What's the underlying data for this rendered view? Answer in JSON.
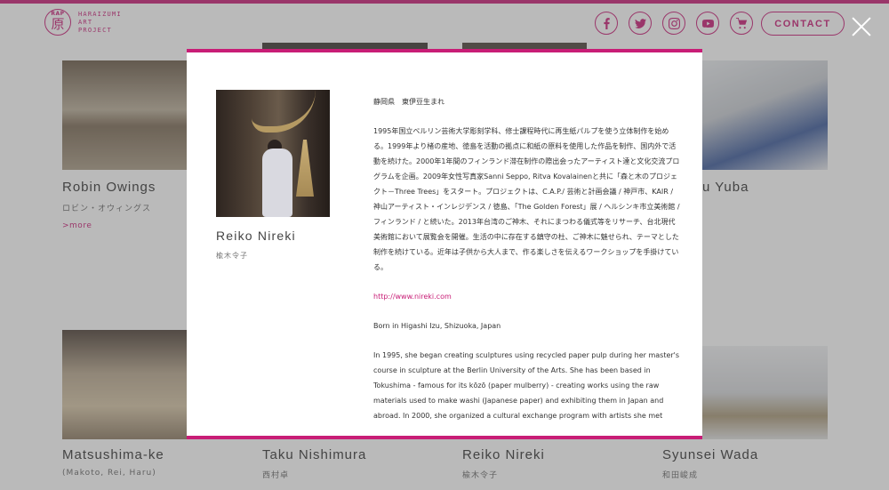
{
  "header": {
    "logo_abbr": "RAP",
    "logo_kanji": "原",
    "logo_lines": [
      "HARAIZUMI",
      "ART",
      "PROJECT"
    ],
    "social_icons": [
      "facebook-icon",
      "twitter-icon",
      "instagram-icon",
      "youtube-icon",
      "cart-icon"
    ],
    "contact_label": "CONTACT"
  },
  "artists": [
    {
      "name": "Robin Owings",
      "kana": "ロビン・オウィングス",
      "more": ">more"
    },
    {
      "name": "u Yuba"
    },
    {
      "name": "Matsushima-ke",
      "kana": "(Makoto, Rei, Haru)"
    },
    {
      "name": "Taku Nishimura",
      "kana": "西村卓"
    },
    {
      "name": "Reiko Nireki",
      "kana": "楡木令子"
    },
    {
      "name": "Syunsei Wada",
      "kana": "和田峻成"
    }
  ],
  "modal": {
    "name": "Reiko Nireki",
    "kana": "楡木令子",
    "bio": [
      "静岡県　東伊豆生まれ",
      "1995年国立ベルリン芸術大学彫刻学科、修士課程時代に再生紙パルプを使う立体制作を始める。1999年より楮の産地、徳島を活動の拠点に和紙の原料を使用した作品を制作、国内外で活動を続けた。2000年1年間のフィンランド滞在制作の際出会ったアーティスト達と文化交流プログラムを企画。2009年女性写真家Sanni Seppo, Ritva Kovalainenと共に「森と木のプロジェクト－Three Trees」をスタート。プロジェクトは、C.A.P./ 芸術と計画会議 / 神戸市、KAIR / 神山アーティスト・インレジデンス / 徳島、「The Golden Forest」展 / ヘルシンキ市立美術館 / フィンランド / と続いた。2013年台湾のご神木、それにまつわる儀式等をリサーチ、台北現代美術館において展覧会を開催。生活の中に存在する鎮守の杜、ご神木に魅せられ、テーマとした制作を続けている。近年は子供から大人まで、作る楽しさを伝えるワークショップを手掛けている。",
      "http://www.nireki.com",
      "Born in Higashi Izu, Shizuoka, Japan",
      "In 1995, she began creating sculptures using recycled paper pulp during her master's course in sculpture at the Berlin University of the Arts. She has been based in Tokushima - famous for its kōzō (paper mulberry) - creating works using the raw materials used to make washi (Japanese paper) and exhibiting them in Japan and abroad. In 2000, she organized a cultural exchange program with artists she met"
    ]
  }
}
